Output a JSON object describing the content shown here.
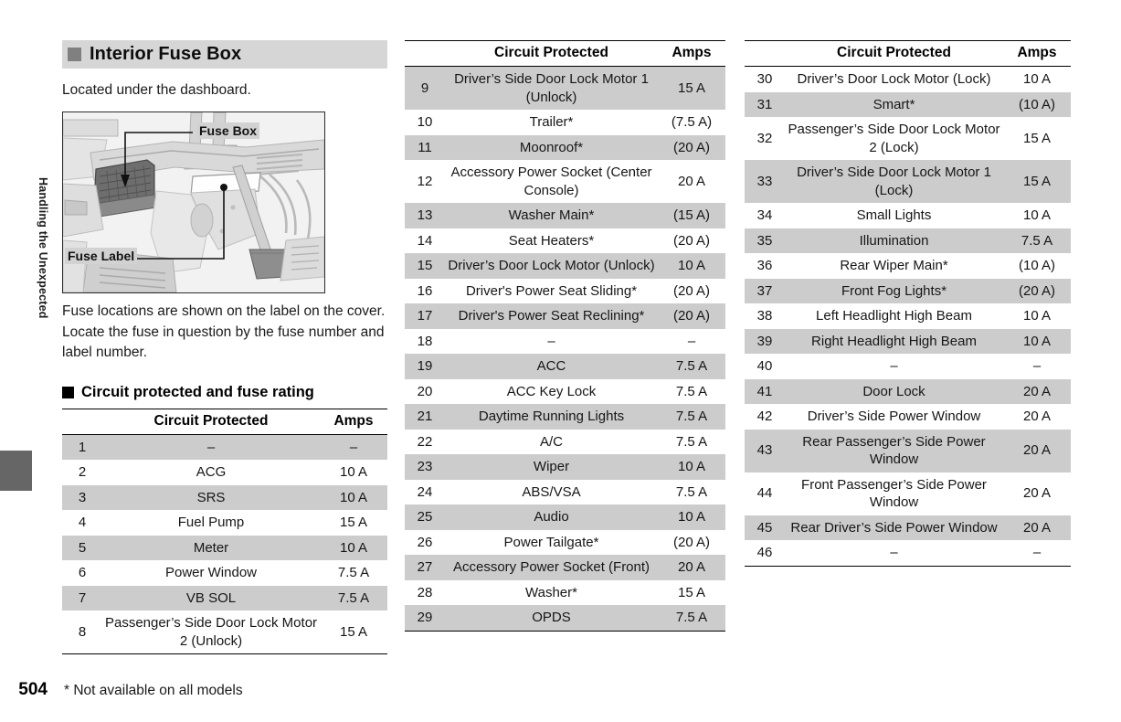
{
  "sidebar": {
    "chapter_label": "Handling the Unexpected"
  },
  "section": {
    "title": "Interior Fuse Box",
    "intro": "Located under the dashboard.",
    "paragraph_1": "Fuse locations are shown on the label on the cover.",
    "paragraph_2": "Locate the fuse in question by the fuse number and label number.",
    "subheading": "Circuit protected and fuse rating"
  },
  "figure": {
    "callout_fuse_box": "Fuse Box",
    "callout_fuse_label": "Fuse Label"
  },
  "table_headers": {
    "number": "",
    "circuit": "Circuit Protected",
    "amps": "Amps"
  },
  "colors": {
    "row_shade": "#cccccc",
    "heading_band": "#d6d6d6",
    "heading_square": "#808080",
    "sub_square": "#000000",
    "side_tab": "#666666"
  },
  "footer": {
    "page_number": "504",
    "note": "* Not available on all models"
  },
  "tables": [
    {
      "id": "table-left",
      "rows": [
        {
          "num": "1",
          "circuit": "–",
          "amps": "–",
          "shaded": true
        },
        {
          "num": "2",
          "circuit": "ACG",
          "amps": "10 A",
          "shaded": false
        },
        {
          "num": "3",
          "circuit": "SRS",
          "amps": "10 A",
          "shaded": true
        },
        {
          "num": "4",
          "circuit": "Fuel Pump",
          "amps": "15 A",
          "shaded": false
        },
        {
          "num": "5",
          "circuit": "Meter",
          "amps": "10 A",
          "shaded": true
        },
        {
          "num": "6",
          "circuit": "Power Window",
          "amps": "7.5 A",
          "shaded": false
        },
        {
          "num": "7",
          "circuit": "VB SOL",
          "amps": "7.5 A",
          "shaded": true
        },
        {
          "num": "8",
          "circuit": "Passenger’s Side Door Lock Motor 2 (Unlock)",
          "amps": "15 A",
          "shaded": false
        }
      ]
    },
    {
      "id": "table-middle",
      "rows": [
        {
          "num": "9",
          "circuit": "Driver’s Side Door Lock Motor 1 (Unlock)",
          "amps": "15 A",
          "shaded": true
        },
        {
          "num": "10",
          "circuit": "Trailer*",
          "amps": "(7.5 A)",
          "shaded": false
        },
        {
          "num": "11",
          "circuit": "Moonroof*",
          "amps": "(20 A)",
          "shaded": true
        },
        {
          "num": "12",
          "circuit": "Accessory Power Socket (Center Console)",
          "amps": "20 A",
          "shaded": false
        },
        {
          "num": "13",
          "circuit": "Washer Main*",
          "amps": "(15 A)",
          "shaded": true
        },
        {
          "num": "14",
          "circuit": "Seat Heaters*",
          "amps": "(20 A)",
          "shaded": false
        },
        {
          "num": "15",
          "circuit": "Driver’s Door Lock Motor (Unlock)",
          "amps": "10 A",
          "shaded": true
        },
        {
          "num": "16",
          "circuit": "Driver's Power Seat Sliding*",
          "amps": "(20 A)",
          "shaded": false
        },
        {
          "num": "17",
          "circuit": "Driver's Power Seat Reclining*",
          "amps": "(20 A)",
          "shaded": true
        },
        {
          "num": "18",
          "circuit": "–",
          "amps": "–",
          "shaded": false
        },
        {
          "num": "19",
          "circuit": "ACC",
          "amps": "7.5 A",
          "shaded": true
        },
        {
          "num": "20",
          "circuit": "ACC Key Lock",
          "amps": "7.5 A",
          "shaded": false
        },
        {
          "num": "21",
          "circuit": "Daytime Running Lights",
          "amps": "7.5 A",
          "shaded": true
        },
        {
          "num": "22",
          "circuit": "A/C",
          "amps": "7.5 A",
          "shaded": false
        },
        {
          "num": "23",
          "circuit": "Wiper",
          "amps": "10 A",
          "shaded": true
        },
        {
          "num": "24",
          "circuit": "ABS/VSA",
          "amps": "7.5 A",
          "shaded": false
        },
        {
          "num": "25",
          "circuit": "Audio",
          "amps": "10 A",
          "shaded": true
        },
        {
          "num": "26",
          "circuit": "Power Tailgate*",
          "amps": "(20 A)",
          "shaded": false
        },
        {
          "num": "27",
          "circuit": "Accessory Power Socket (Front)",
          "amps": "20 A",
          "shaded": true
        },
        {
          "num": "28",
          "circuit": "Washer*",
          "amps": "15 A",
          "shaded": false
        },
        {
          "num": "29",
          "circuit": "OPDS",
          "amps": "7.5 A",
          "shaded": true
        }
      ]
    },
    {
      "id": "table-right",
      "rows": [
        {
          "num": "30",
          "circuit": "Driver’s Door Lock Motor (Lock)",
          "amps": "10 A",
          "shaded": false
        },
        {
          "num": "31",
          "circuit": "Smart*",
          "amps": "(10 A)",
          "shaded": true
        },
        {
          "num": "32",
          "circuit": "Passenger’s Side Door Lock Motor 2 (Lock)",
          "amps": "15 A",
          "shaded": false
        },
        {
          "num": "33",
          "circuit": "Driver’s Side Door Lock Motor 1 (Lock)",
          "amps": "15 A",
          "shaded": true
        },
        {
          "num": "34",
          "circuit": "Small Lights",
          "amps": "10 A",
          "shaded": false
        },
        {
          "num": "35",
          "circuit": "Illumination",
          "amps": "7.5 A",
          "shaded": true
        },
        {
          "num": "36",
          "circuit": "Rear Wiper Main*",
          "amps": "(10 A)",
          "shaded": false
        },
        {
          "num": "37",
          "circuit": "Front Fog Lights*",
          "amps": "(20 A)",
          "shaded": true
        },
        {
          "num": "38",
          "circuit": "Left Headlight High Beam",
          "amps": "10 A",
          "shaded": false
        },
        {
          "num": "39",
          "circuit": "Right Headlight High Beam",
          "amps": "10 A",
          "shaded": true
        },
        {
          "num": "40",
          "circuit": "–",
          "amps": "–",
          "shaded": false
        },
        {
          "num": "41",
          "circuit": "Door Lock",
          "amps": "20 A",
          "shaded": true
        },
        {
          "num": "42",
          "circuit": "Driver’s Side Power Window",
          "amps": "20 A",
          "shaded": false
        },
        {
          "num": "43",
          "circuit": "Rear Passenger’s Side Power Window",
          "amps": "20 A",
          "shaded": true
        },
        {
          "num": "44",
          "circuit": "Front Passenger’s Side Power Window",
          "amps": "20 A",
          "shaded": false
        },
        {
          "num": "45",
          "circuit": "Rear Driver’s Side Power Window",
          "amps": "20 A",
          "shaded": true
        },
        {
          "num": "46",
          "circuit": "–",
          "amps": "–",
          "shaded": false
        }
      ]
    }
  ]
}
